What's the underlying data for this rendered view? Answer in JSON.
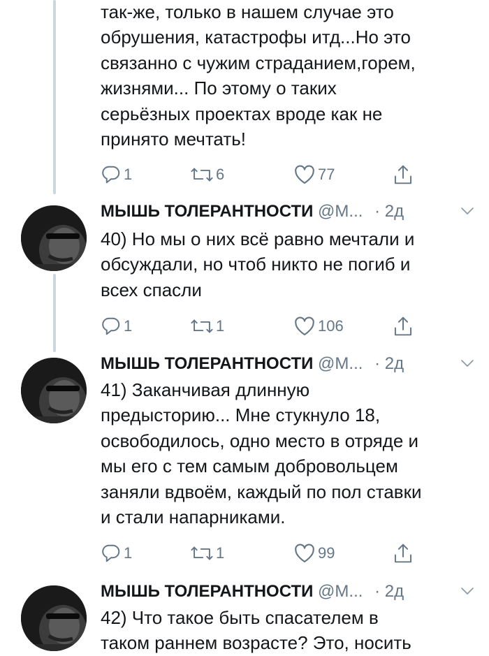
{
  "tweets": [
    {
      "continuation": true,
      "text": "так-же, только в нашем случае это\nобрушения, катастрофы итд...Но это\nсвязанно с чужим страданием,горем,\nжизнями... По этому о таких\nсерьёзных проектах вроде как не\nпринято мечтать!",
      "replies": "1",
      "retweets": "6",
      "likes": "77"
    },
    {
      "name": "МЫШЬ ТОЛЕРАНТНОСТИ",
      "handle": "@М...",
      "time": "· 2д",
      "text": "40) Но мы о них всё равно мечтали и\nобсуждали, но чтоб никто не погиб и\nвсех спасли",
      "replies": "1",
      "retweets": "1",
      "likes": "106"
    },
    {
      "name": "МЫШЬ ТОЛЕРАНТНОСТИ",
      "handle": "@М...",
      "time": "· 2д",
      "text": "41) Заканчивая длинную\nпредысторию... Мне стукнуло 18,\nосвободилось, одно место в отряде и\nмы его с тем самым добровольцем\nзаняли вдвоём, каждый по пол ставки\nи стали напарниками.",
      "replies": "1",
      "retweets": "1",
      "likes": "99"
    },
    {
      "name": "МЫШЬ ТОЛЕРАНТНОСТИ",
      "handle": "@М...",
      "time": "· 2д",
      "text": "42) Что такое быть спасателем в\nтаком раннем возрасте? Это, носить"
    }
  ],
  "colors": {
    "text": "#14171a",
    "secondary": "#657786",
    "thread_line": "#ccd6dd"
  },
  "icons": [
    "reply-icon",
    "retweet-icon",
    "like-icon",
    "share-icon",
    "chevron-down-icon"
  ]
}
